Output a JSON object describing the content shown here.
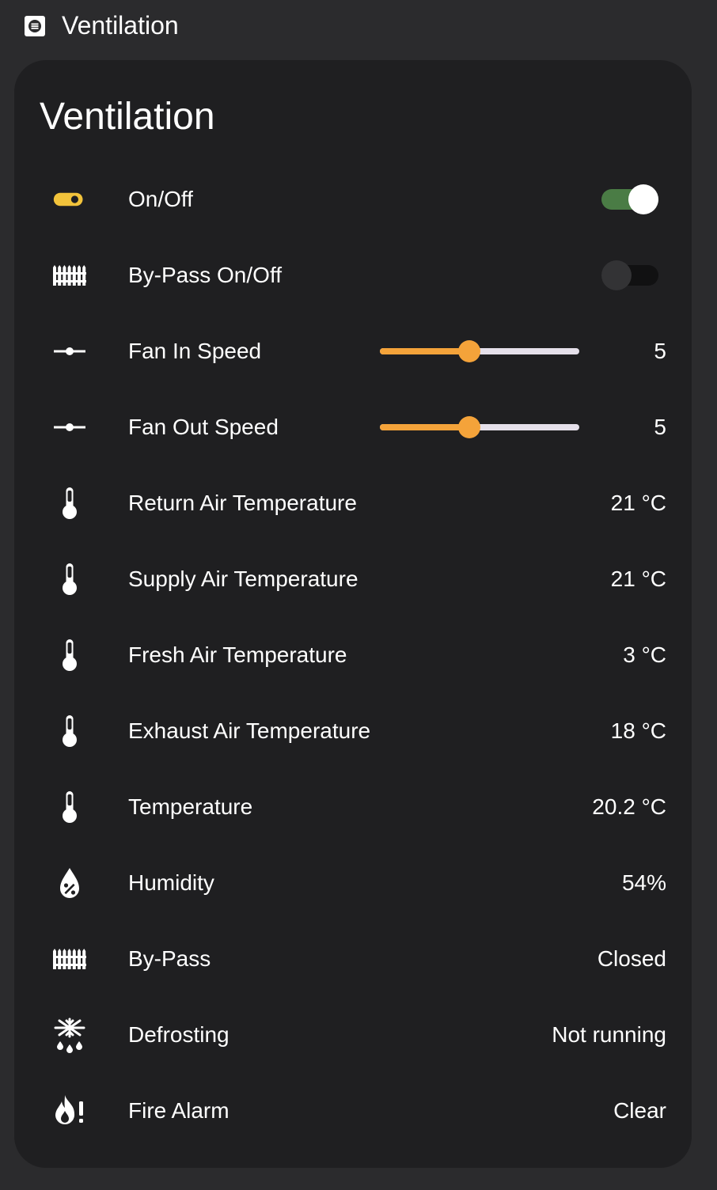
{
  "header": {
    "title": "Ventilation",
    "icon": "list-box-icon"
  },
  "card": {
    "title": "Ventilation",
    "rows": [
      {
        "label": "On/Off",
        "type": "toggle",
        "on": true,
        "icon": "toggle-switch-icon"
      },
      {
        "label": "By-Pass On/Off",
        "type": "toggle",
        "on": false,
        "icon": "fence-icon"
      },
      {
        "label": "Fan In Speed",
        "type": "slider",
        "value": "5",
        "level": 0.45,
        "icon": "slider-icon"
      },
      {
        "label": "Fan Out Speed",
        "type": "slider",
        "value": "5",
        "level": 0.45,
        "icon": "slider-icon"
      },
      {
        "label": "Return Air Temperature",
        "type": "sensor",
        "value": "21 °C",
        "icon": "thermometer-icon"
      },
      {
        "label": "Supply Air Temperature",
        "type": "sensor",
        "value": "21 °C",
        "icon": "thermometer-icon"
      },
      {
        "label": "Fresh Air Temperature",
        "type": "sensor",
        "value": "3 °C",
        "icon": "thermometer-icon"
      },
      {
        "label": "Exhaust Air Temperature",
        "type": "sensor",
        "value": "18 °C",
        "icon": "thermometer-icon"
      },
      {
        "label": "Temperature",
        "type": "sensor",
        "value": "20.2 °C",
        "icon": "thermometer-icon"
      },
      {
        "label": "Humidity",
        "type": "sensor",
        "value": "54%",
        "icon": "water-percent-icon"
      },
      {
        "label": "By-Pass",
        "type": "sensor",
        "value": "Closed",
        "icon": "fence-icon"
      },
      {
        "label": "Defrosting",
        "type": "sensor",
        "value": "Not running",
        "icon": "snowflake-melt-icon"
      },
      {
        "label": "Fire Alarm",
        "type": "sensor",
        "value": "Clear",
        "icon": "fire-alert-icon"
      }
    ]
  },
  "colors": {
    "toggle_on_track": "#4a7c45",
    "toggle_off_track": "#111112",
    "accent_orange": "#f4a33a",
    "icon_yellow": "#f2c33b"
  }
}
